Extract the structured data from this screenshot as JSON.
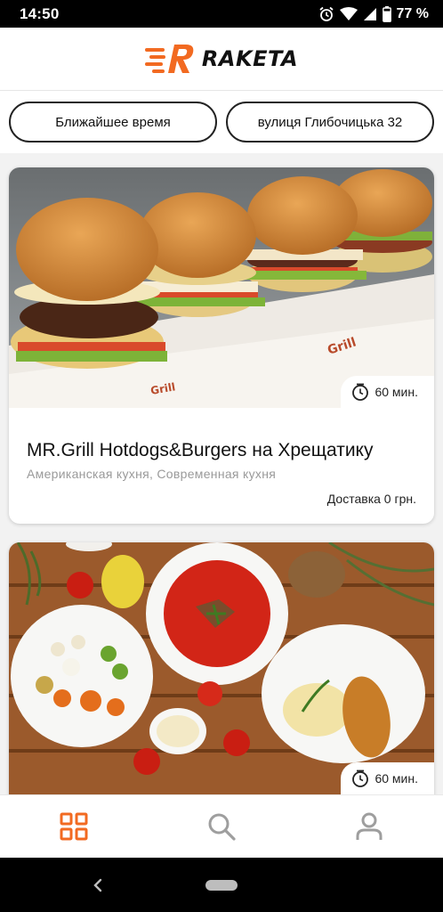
{
  "status_bar": {
    "time": "14:50",
    "battery_percent": "77 %",
    "icons": [
      "alarm-icon",
      "wifi-icon",
      "cell-signal-icon",
      "battery-icon"
    ]
  },
  "header": {
    "brand": "RAKETA",
    "brand_color": "#f26a21",
    "logo_icon": "rocket-r-logo-icon"
  },
  "filters": {
    "time_label": "Ближайшее время",
    "address_label": "вулиця Глибочицька 32"
  },
  "restaurants": [
    {
      "name": "MR.Grill Hotdogs&Burgers на Хрещатику",
      "cuisines": "Американская кухня, Современная кухня",
      "eta": "60 мин.",
      "delivery": "Доставка 0 грн.",
      "image": "burgers-photo"
    },
    {
      "name": "",
      "eta": "60 мин.",
      "image": "borscht-table-photo"
    }
  ],
  "bottom_nav": {
    "items": [
      "home-grid-icon",
      "search-icon",
      "profile-icon"
    ],
    "active": "home-grid-icon",
    "active_color": "#f26a21",
    "inactive_color": "#9e9e9e"
  },
  "system_nav": {
    "items": [
      "back-icon",
      "home-pill"
    ]
  }
}
